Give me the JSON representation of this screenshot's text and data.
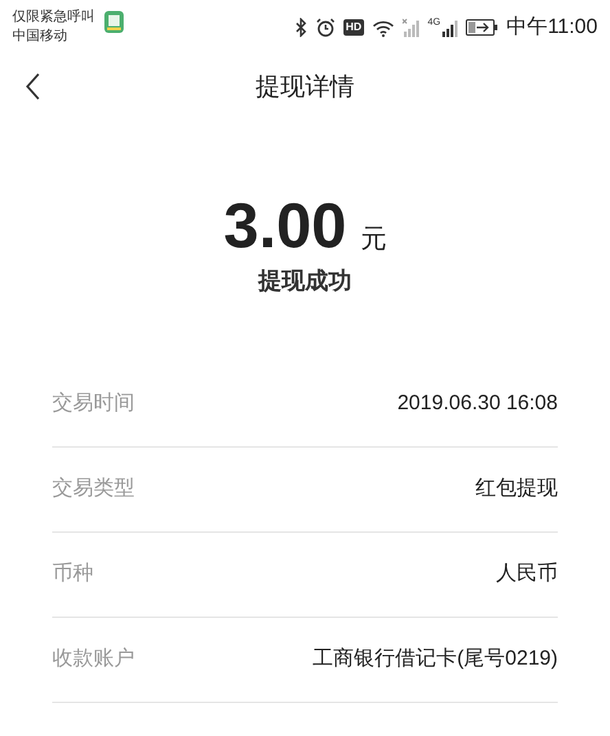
{
  "status_bar": {
    "carrier_lines": [
      "仅限紧急呼叫",
      "中国移动"
    ],
    "hd_badge": "HD",
    "network_label": "4G",
    "time": "中午11:00"
  },
  "header": {
    "title": "提现详情"
  },
  "summary": {
    "amount": "3.00",
    "unit": "元",
    "status": "提现成功"
  },
  "details": [
    {
      "label": "交易时间",
      "value": "2019.06.30 16:08"
    },
    {
      "label": "交易类型",
      "value": "红包提现"
    },
    {
      "label": "币种",
      "value": "人民币"
    },
    {
      "label": "收款账户",
      "value": "工商银行借记卡(尾号0219)"
    }
  ]
}
